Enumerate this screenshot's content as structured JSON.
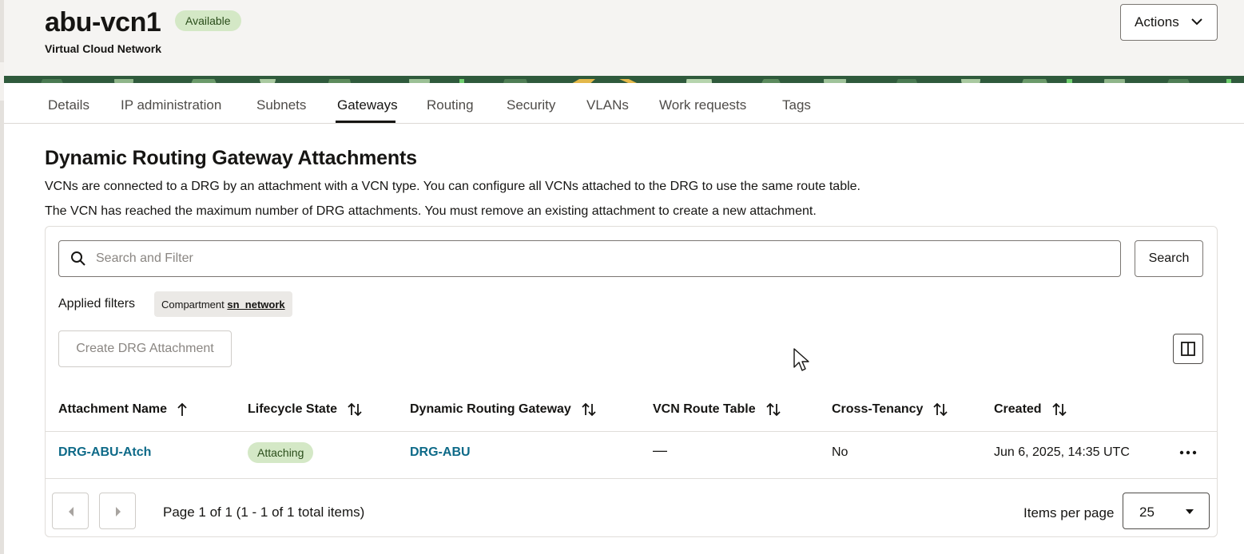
{
  "header": {
    "title": "abu-vcn1",
    "status_badge": "Available",
    "subtitle": "Virtual Cloud Network",
    "actions_label": "Actions"
  },
  "tabs": [
    {
      "label": "Details"
    },
    {
      "label": "IP administration"
    },
    {
      "label": "Subnets"
    },
    {
      "label": "Gateways",
      "active": true
    },
    {
      "label": "Routing"
    },
    {
      "label": "Security"
    },
    {
      "label": "VLANs"
    },
    {
      "label": "Work requests"
    },
    {
      "label": "Tags"
    }
  ],
  "section": {
    "title": "Dynamic Routing Gateway Attachments",
    "description_1": "VCNs are connected to a DRG by an attachment with a VCN type. You can configure all VCNs attached to the DRG to use the same route table.",
    "description_2": "The VCN has reached the maximum number of DRG attachments. You must remove an existing attachment to create a new attachment."
  },
  "search": {
    "placeholder": "Search and Filter",
    "value": "",
    "button_label": "Search"
  },
  "filters": {
    "label": "Applied filters",
    "chip_key": "Compartment",
    "chip_value": "sn_network"
  },
  "toolbar": {
    "create_label": "Create DRG Attachment"
  },
  "table": {
    "columns": [
      {
        "label": "Attachment Name",
        "sort": "ascending"
      },
      {
        "label": "Lifecycle State",
        "sort": "none"
      },
      {
        "label": "Dynamic Routing Gateway",
        "sort": "none"
      },
      {
        "label": "VCN Route Table",
        "sort": "none"
      },
      {
        "label": "Cross-Tenancy",
        "sort": "none"
      },
      {
        "label": "Created",
        "sort": "none"
      }
    ],
    "rows": [
      {
        "attachment_name": "DRG-ABU-Atch",
        "lifecycle_state": "Attaching",
        "drg": "DRG-ABU",
        "route_table": "—",
        "cross_tenancy": "No",
        "created": "Jun 6, 2025, 14:35 UTC"
      }
    ]
  },
  "pagination": {
    "summary": "Page 1 of 1 (1 - 1 of 1 total items)",
    "items_per_page_label": "Items per page",
    "items_per_page_value": "25"
  },
  "icons": {
    "search": "search-icon",
    "chevron": "chevron-down-icon",
    "sort": "sort-icon",
    "more": "more-actions-icon",
    "columns": "columns-icon",
    "prev": "chevron-left-icon",
    "next": "chevron-right-icon"
  },
  "colors": {
    "link": "#0e6a88",
    "badge_bg": "#d4e8c6",
    "banner_green": "#2f5a3c",
    "header_bg": "#f5f4f2"
  }
}
